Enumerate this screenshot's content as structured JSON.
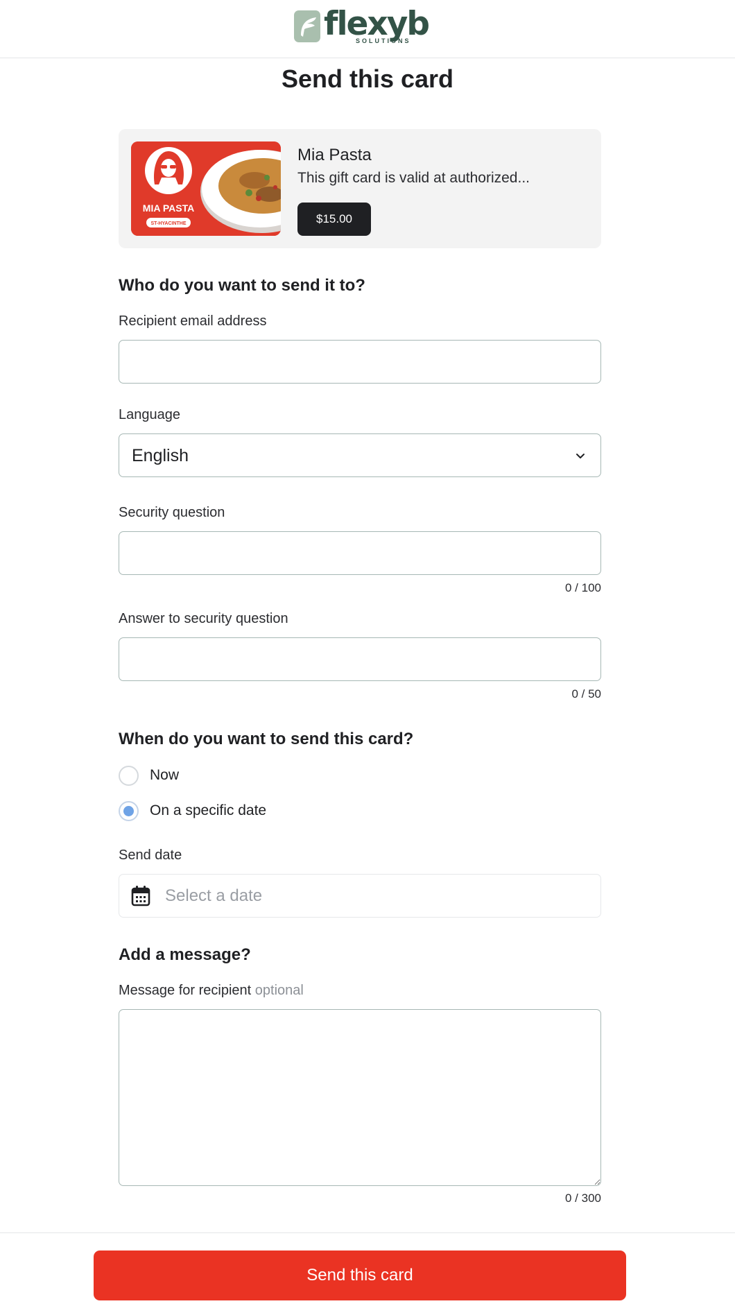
{
  "header": {
    "logo_text": "flexyb",
    "logo_subtext": "SOLUTIONS"
  },
  "page": {
    "title": "Send this card"
  },
  "card": {
    "name": "Mia Pasta",
    "description": "This gift card is valid at authorized...",
    "price": "$15.00",
    "image_brand": "MIA PASTA",
    "image_location": "ST-HYACINTHE"
  },
  "recipient_section": {
    "title": "Who do you want to send it to?",
    "email_label": "Recipient email address",
    "email_value": "",
    "language_label": "Language",
    "language_value": "English",
    "security_question_label": "Security question",
    "security_question_value": "",
    "security_question_counter": "0 / 100",
    "answer_label": "Answer to security question",
    "answer_value": "",
    "answer_counter": "0 / 50"
  },
  "schedule_section": {
    "title": "When do you want to send this card?",
    "options": [
      {
        "label": "Now",
        "checked": false
      },
      {
        "label": "On a specific date",
        "checked": true
      }
    ],
    "send_date_label": "Send date",
    "send_date_placeholder": "Select a date"
  },
  "message_section": {
    "title": "Add a message?",
    "message_label": "Message for recipient",
    "message_optional": "optional",
    "message_value": "",
    "message_counter": "0 / 300"
  },
  "footer": {
    "send_button_label": "Send this card"
  },
  "colors": {
    "accent": "#ea3323",
    "brand_green": "#335347",
    "radio_selected": "#6fa3e6",
    "price_badge": "#1f2023"
  },
  "icons": {
    "chevron": "chevron-down-icon",
    "calendar": "calendar-icon"
  }
}
